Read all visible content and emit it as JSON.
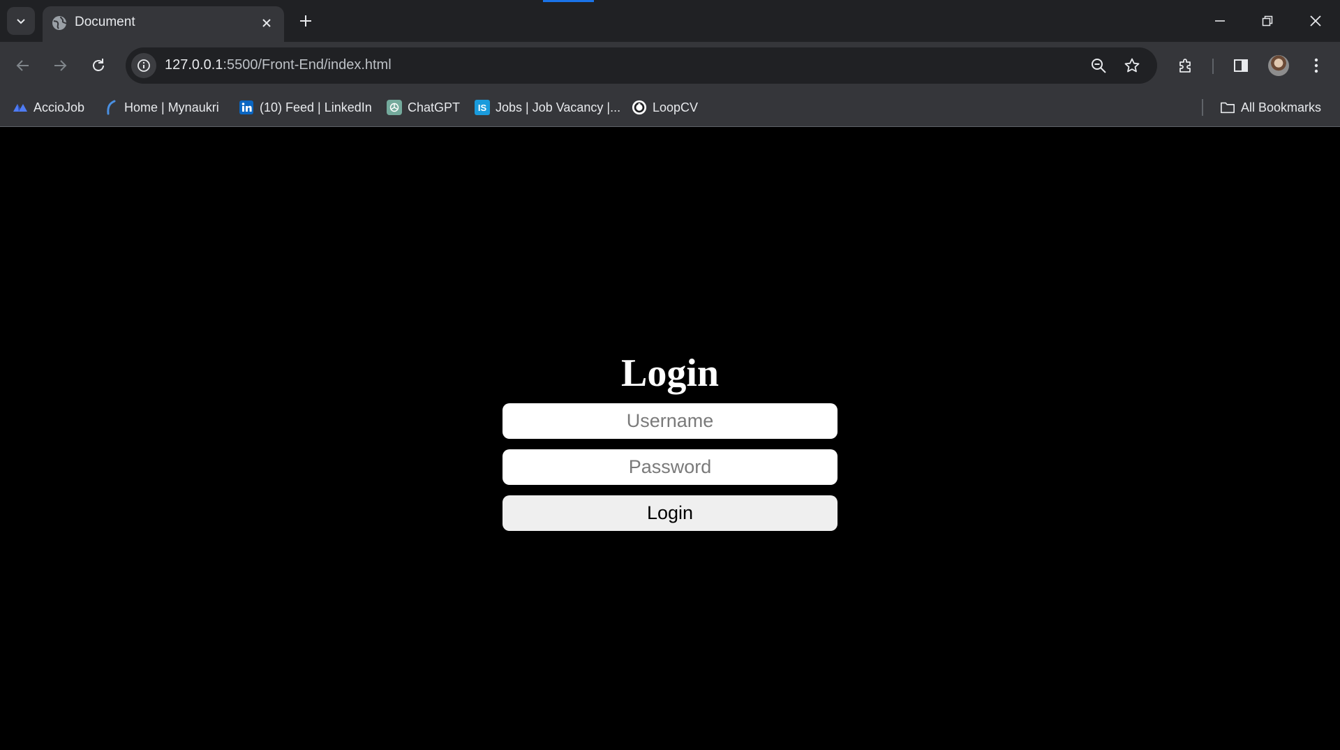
{
  "browser": {
    "tab": {
      "title": "Document"
    },
    "loading_color": "#1a73e8",
    "address": {
      "host": "127.0.0.1",
      "path": ":5500/Front-End/index.html"
    },
    "bookmarks": [
      {
        "label": "AccioJob",
        "icon": "acciojob-icon"
      },
      {
        "label": "Home | Mynaukri",
        "icon": "mynaukri-icon"
      },
      {
        "label": "(10) Feed | LinkedIn",
        "icon": "linkedin-icon"
      },
      {
        "label": "ChatGPT",
        "icon": "chatgpt-icon"
      },
      {
        "label": "Jobs | Job Vacancy |...",
        "icon": "jobvacancy-icon"
      },
      {
        "label": "LoopCV",
        "icon": "loopcv-icon"
      }
    ],
    "all_bookmarks_label": "All Bookmarks"
  },
  "page": {
    "title": "Login",
    "username_placeholder": "Username",
    "password_placeholder": "Password",
    "submit_label": "Login"
  }
}
